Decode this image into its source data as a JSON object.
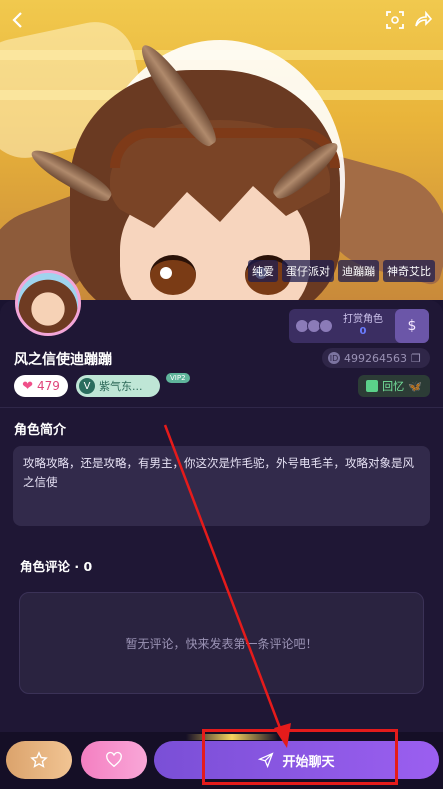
{
  "hero": {
    "tags": [
      "纯爱",
      "蛋仔派对",
      "迪蹦蹦",
      "神奇艾比"
    ]
  },
  "header": {
    "back_icon": "chevron-left-icon",
    "icons": [
      "scan-icon",
      "share-icon"
    ]
  },
  "reward": {
    "label": "打赏角色",
    "count": "0",
    "icon": "money-bag-icon"
  },
  "profile": {
    "name": "风之信使迪蹦蹦",
    "id": "499264563",
    "likes": "479",
    "creator_name": "紫气东...",
    "vip_label": "VIP2",
    "memory_label": "回忆"
  },
  "intro": {
    "title": "角色简介",
    "text": "攻略攻略，还是攻略，有男主，你这次是炸毛驼，外号电毛羊，攻略对象是风之信使"
  },
  "comments": {
    "title": "角色评论 · 0",
    "empty_text": "暂无评论，快来发表第一条评论吧！"
  },
  "bottom_bar": {
    "chat_label": "开始聊天"
  },
  "colors": {
    "panel_bg": "#1f1735",
    "accent_purple": "#8a57e4",
    "highlight_red": "#e51b1b"
  }
}
